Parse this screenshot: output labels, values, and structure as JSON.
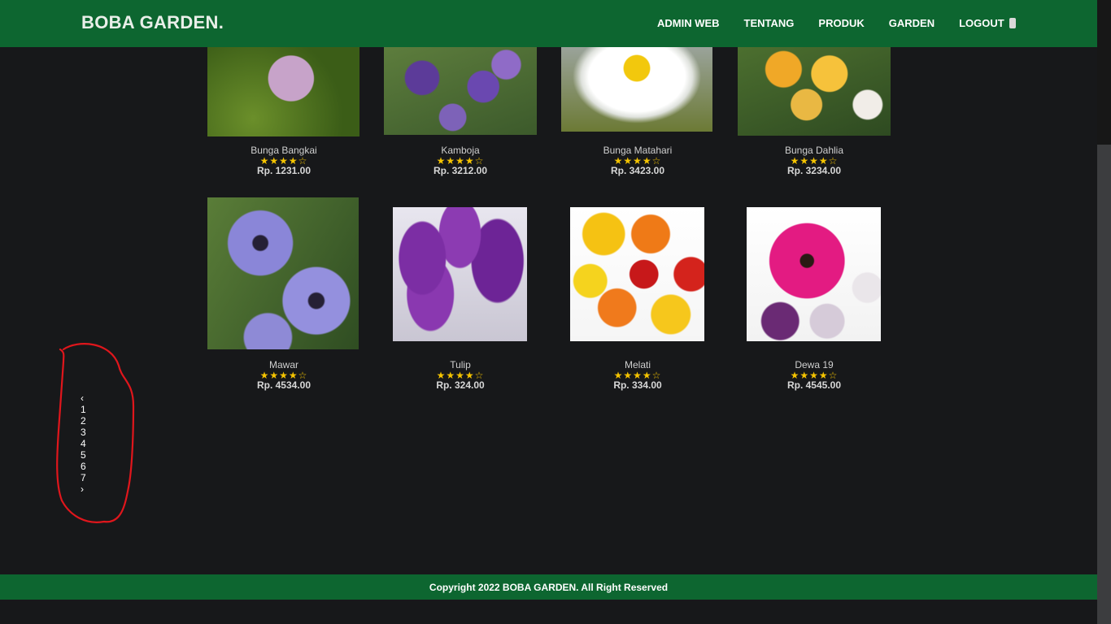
{
  "brand": "BOBA GARDEN.",
  "nav": [
    {
      "label": "ADMIN WEB"
    },
    {
      "label": "TENTANG"
    },
    {
      "label": "PRODUK"
    },
    {
      "label": "GARDEN"
    },
    {
      "label": "LOGOUT"
    }
  ],
  "cart_icon": "cart-icon",
  "products": [
    {
      "name": "Bunga Bangkai",
      "rating": "★★★★☆",
      "price": "Rp. 1231.00"
    },
    {
      "name": "Kamboja",
      "rating": "★★★★☆",
      "price": "Rp. 3212.00"
    },
    {
      "name": "Bunga Matahari",
      "rating": "★★★★☆",
      "price": "Rp. 3423.00"
    },
    {
      "name": "Bunga Dahlia",
      "rating": "★★★★☆",
      "price": "Rp. 3234.00"
    },
    {
      "name": "Mawar",
      "rating": "★★★★☆",
      "price": "Rp. 4534.00"
    },
    {
      "name": "Tulip",
      "rating": "★★★★☆",
      "price": "Rp. 324.00"
    },
    {
      "name": "Melati",
      "rating": "★★★★☆",
      "price": "Rp. 334.00"
    },
    {
      "name": "Dewa 19",
      "rating": "★★★★☆",
      "price": "Rp. 4545.00"
    }
  ],
  "pagination": {
    "prev": "‹",
    "pages": [
      "1",
      "2",
      "3",
      "4",
      "5",
      "6",
      "7"
    ],
    "next": "›"
  },
  "footer": "Copyright 2022 BOBA GARDEN. All Right Reserved",
  "colors": {
    "header": "#0d6630",
    "background": "#17181a",
    "star": "#f5c400",
    "annotation": "#e0161c"
  }
}
